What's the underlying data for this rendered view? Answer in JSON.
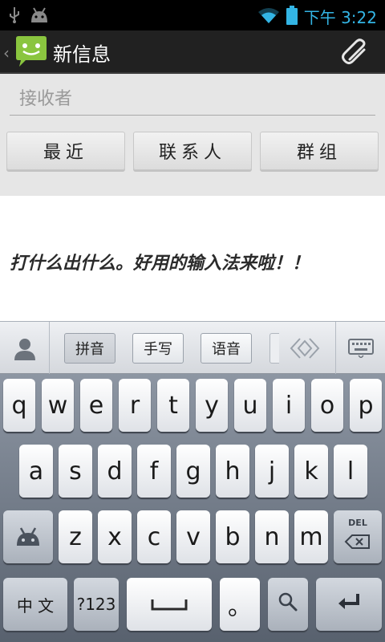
{
  "status_bar": {
    "time": "下午 3:22",
    "icons": [
      "usb-icon",
      "android-debug-icon",
      "wifi-icon",
      "battery-icon"
    ]
  },
  "action_bar": {
    "title": "新信息",
    "icons": [
      "back-chevron-icon",
      "messaging-app-icon",
      "attach-paperclip-icon"
    ]
  },
  "compose": {
    "to_placeholder": "接收者",
    "buttons": [
      "最近",
      "联系人",
      "群组"
    ],
    "message_text": "打什么出什么。好用的输入法来啦！！"
  },
  "ime_toolbar": {
    "tabs": [
      "拼音",
      "手写",
      "语音"
    ],
    "active_tab": "拼音",
    "icons": [
      "contact-icon",
      "scroll-icon",
      "keyboard-icon"
    ]
  },
  "keyboard": {
    "row1": [
      "q",
      "w",
      "e",
      "r",
      "t",
      "y",
      "u",
      "i",
      "o",
      "p"
    ],
    "row2": [
      "a",
      "s",
      "d",
      "f",
      "g",
      "h",
      "j",
      "k",
      "l"
    ],
    "row3": [
      "z",
      "x",
      "c",
      "v",
      "b",
      "n",
      "m"
    ],
    "del_label": "DEL",
    "lang_label": "中 文",
    "symbols_label": "?123",
    "period_label": "。",
    "icons": [
      "android-settings-icon",
      "delete-icon",
      "space-icon",
      "search-icon",
      "enter-icon"
    ]
  },
  "colors": {
    "accent": "#33b5e5",
    "app_green": "#8ac53f",
    "action_bar": "#212121"
  }
}
